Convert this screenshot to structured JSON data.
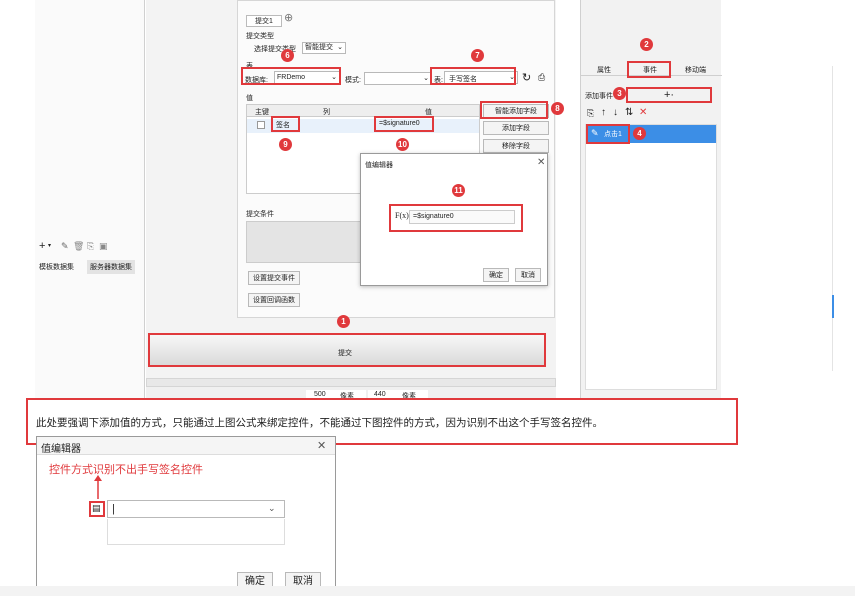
{
  "colors": {
    "accent": "#e0393c",
    "selected_blue": "#3c8ee6",
    "panel_bg": "#f0f0f0"
  },
  "tabs": {
    "top_tab": "提交1"
  },
  "submit_type": {
    "title": "提交类型",
    "select_label": "选择提交类型",
    "smart_submit": "智能提交"
  },
  "table_section": {
    "title": "表",
    "db_label": "数据库:",
    "db_value": "FRDemo",
    "mode_label": "模式:",
    "table_label": "表:",
    "table_value": "手写签名"
  },
  "values_section": {
    "title": "值",
    "col_key": "主键",
    "col_column": "列",
    "col_value": "值",
    "row_column": "签名",
    "row_value": "=$signature0"
  },
  "side_buttons": {
    "smart_add": "智能添加字段",
    "add_field": "添加字段",
    "remove_field": "移除字段"
  },
  "condition": {
    "title": "提交条件"
  },
  "bottom_buttons": {
    "set_event": "设置提交事件",
    "set_callback": "设置回调函数",
    "submit": "提交"
  },
  "dataset_panel": {
    "tab1": "模板数据集",
    "tab2": "服务器数据集"
  },
  "right_panel": {
    "tab_props": "属性",
    "tab_events": "事件",
    "tab_mobile": "移动端",
    "add_event_label": "添加事件",
    "add_symbol": "+·",
    "event_item": "点击1"
  },
  "value_editor": {
    "title": "值编辑器",
    "formula_value": "=$signature0",
    "ok": "确定",
    "cancel": "取消"
  },
  "status": {
    "width_value": "500",
    "width_unit": "像素",
    "height_value": "440",
    "height_unit": "像素"
  },
  "note": "此处要强调下添加值的方式，只能通过上图公式来绑定控件，不能通过下图控件的方式，因为识别不出这个手写签名控件。",
  "value_editor2": {
    "title": "值编辑器",
    "annotation": "控件方式识别不出手写签名控件",
    "ok": "确定",
    "cancel": "取消"
  },
  "markers": [
    "1",
    "2",
    "3",
    "4",
    "6",
    "7",
    "8",
    "9",
    "10",
    "11"
  ],
  "icons": [
    "add-icon",
    "edit-icon",
    "delete-icon",
    "copy-icon",
    "preview-icon",
    "refresh-icon",
    "export-icon",
    "arrow-up-icon",
    "arrow-down-icon",
    "sort-icon",
    "close-x-icon",
    "dropdown-arrow-icon",
    "widget-icon",
    "formula-icon",
    "pencil-icon"
  ]
}
